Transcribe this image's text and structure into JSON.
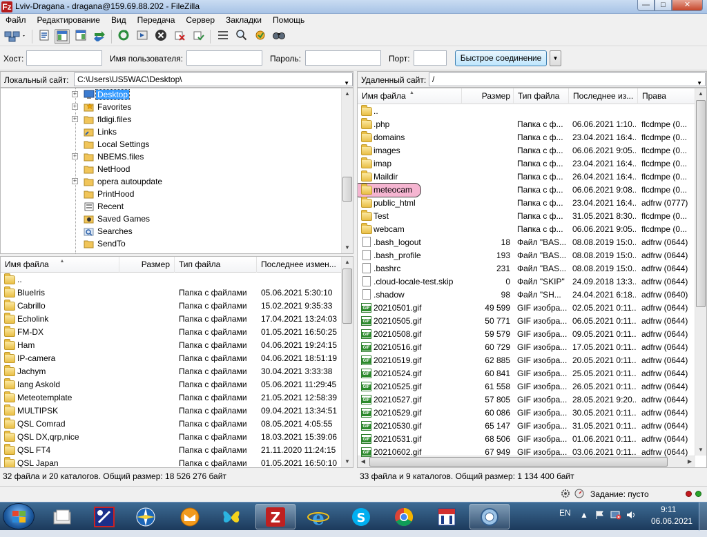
{
  "title": {
    "text": "Lviv-Dragana - dragana@159.69.88.202 - FileZilla",
    "app_icon": "Fz"
  },
  "menu": [
    "Файл",
    "Редактирование",
    "Вид",
    "Передача",
    "Сервер",
    "Закладки",
    "Помощь"
  ],
  "quickconnect": {
    "host_label": "Хост:",
    "host_value": "",
    "user_label": "Имя пользователя:",
    "user_value": "",
    "pass_label": "Пароль:",
    "pass_value": "",
    "port_label": "Порт:",
    "port_value": "",
    "button": "Быстрое соединение"
  },
  "local": {
    "site_label": "Локальный сайт:",
    "path": "C:\\Users\\US5WAC\\Desktop\\",
    "tree": [
      {
        "name": "Desktop",
        "icon": "desktop-icon",
        "expander": "+",
        "selected": true
      },
      {
        "name": "Favorites",
        "icon": "star-folder-icon",
        "expander": "+"
      },
      {
        "name": "fldigi.files",
        "icon": "folder-icon",
        "expander": "+"
      },
      {
        "name": "Links",
        "icon": "links-folder-icon",
        "expander": ""
      },
      {
        "name": "Local Settings",
        "icon": "folder-icon",
        "expander": ""
      },
      {
        "name": "NBEMS.files",
        "icon": "folder-icon",
        "expander": "+"
      },
      {
        "name": "NetHood",
        "icon": "folder-icon",
        "expander": ""
      },
      {
        "name": "opera autoupdate",
        "icon": "folder-icon",
        "expander": "+"
      },
      {
        "name": "PrintHood",
        "icon": "folder-icon",
        "expander": ""
      },
      {
        "name": "Recent",
        "icon": "recent-icon",
        "expander": ""
      },
      {
        "name": "Saved Games",
        "icon": "saved-games-icon",
        "expander": ""
      },
      {
        "name": "Searches",
        "icon": "search-folder-icon",
        "expander": ""
      },
      {
        "name": "SendTo",
        "icon": "folder-icon",
        "expander": ""
      }
    ],
    "columns": {
      "name": "Имя файла",
      "size": "Размер",
      "type": "Тип файла",
      "modified": "Последнее измен..."
    },
    "files": [
      {
        "name": "..",
        "type": "",
        "modified": ""
      },
      {
        "name": "BlueIris",
        "type": "Папка с файлами",
        "modified": "05.06.2021 5:30:10"
      },
      {
        "name": "Cabrillo",
        "type": "Папка с файлами",
        "modified": "15.02.2021 9:35:33"
      },
      {
        "name": "Echolink",
        "type": "Папка с файлами",
        "modified": "17.04.2021 13:24:03"
      },
      {
        "name": "FM-DX",
        "type": "Папка с файлами",
        "modified": "01.05.2021 16:50:25"
      },
      {
        "name": "Ham",
        "type": "Папка с файлами",
        "modified": "04.06.2021 19:24:15"
      },
      {
        "name": "IP-camera",
        "type": "Папка с файлами",
        "modified": "04.06.2021 18:51:19"
      },
      {
        "name": "Jachym",
        "type": "Папка с файлами",
        "modified": "30.04.2021 3:33:38"
      },
      {
        "name": "Iang Askold",
        "type": "Папка с файлами",
        "modified": "05.06.2021 11:29:45"
      },
      {
        "name": "Meteotemplate",
        "type": "Папка с файлами",
        "modified": "21.05.2021 12:58:39"
      },
      {
        "name": "MULTIPSK",
        "type": "Папка с файлами",
        "modified": "09.04.2021 13:34:51"
      },
      {
        "name": "QSL Comrad",
        "type": "Папка с файлами",
        "modified": "08.05.2021 4:05:55"
      },
      {
        "name": "QSL DX,qrp,nice",
        "type": "Папка с файлами",
        "modified": "18.03.2021 15:39:06"
      },
      {
        "name": "QSL FT4",
        "type": "Папка с файлами",
        "modified": "21.11.2020 11:24:15"
      },
      {
        "name": "QSL Japan",
        "type": "Папка с файлами",
        "modified": "01.05.2021 16:50:10"
      }
    ],
    "status": "32 файла и 20 каталогов. Общий размер: 18 526 276 байт"
  },
  "remote": {
    "site_label": "Удаленный сайт:",
    "path": "/",
    "columns": {
      "name": "Имя файла",
      "size": "Размер",
      "type": "Тип файла",
      "modified": "Последнее из...",
      "perms": "Права"
    },
    "files": [
      {
        "name": "..",
        "kind": "folder",
        "size": "",
        "type": "",
        "modified": "",
        "perms": ""
      },
      {
        "name": ".php",
        "kind": "folder",
        "size": "",
        "type": "Папка с ф...",
        "modified": "06.06.2021 1:10...",
        "perms": "flcdmpe (0..."
      },
      {
        "name": "domains",
        "kind": "folder",
        "size": "",
        "type": "Папка с ф...",
        "modified": "23.04.2021 16:4...",
        "perms": "flcdmpe (0..."
      },
      {
        "name": "images",
        "kind": "folder",
        "size": "",
        "type": "Папка с ф...",
        "modified": "06.06.2021 9:05...",
        "perms": "flcdmpe (0..."
      },
      {
        "name": "imap",
        "kind": "folder",
        "size": "",
        "type": "Папка с ф...",
        "modified": "23.04.2021 16:4...",
        "perms": "flcdmpe (0..."
      },
      {
        "name": "Maildir",
        "kind": "folder",
        "size": "",
        "type": "Папка с ф...",
        "modified": "26.04.2021 16:4...",
        "perms": "flcdmpe (0..."
      },
      {
        "name": "meteocam",
        "kind": "folder",
        "size": "",
        "type": "Папка с ф...",
        "modified": "06.06.2021 9:08...",
        "perms": "flcdmpe (0...",
        "highlight": true
      },
      {
        "name": "public_html",
        "kind": "link",
        "size": "",
        "type": "Папка с ф...",
        "modified": "23.04.2021 16:4...",
        "perms": "adfrw (0777)"
      },
      {
        "name": "Test",
        "kind": "folder",
        "size": "",
        "type": "Папка с ф...",
        "modified": "31.05.2021 8:30...",
        "perms": "flcdmpe (0..."
      },
      {
        "name": "webcam",
        "kind": "folder",
        "size": "",
        "type": "Папка с ф...",
        "modified": "06.06.2021 9:05...",
        "perms": "flcdmpe (0..."
      },
      {
        "name": ".bash_logout",
        "kind": "doc",
        "size": "18",
        "type": "Файл \"BAS...",
        "modified": "08.08.2019 15:0...",
        "perms": "adfrw (0644)"
      },
      {
        "name": ".bash_profile",
        "kind": "doc",
        "size": "193",
        "type": "Файл \"BAS...",
        "modified": "08.08.2019 15:0...",
        "perms": "adfrw (0644)"
      },
      {
        "name": ".bashrc",
        "kind": "doc",
        "size": "231",
        "type": "Файл \"BAS...",
        "modified": "08.08.2019 15:0...",
        "perms": "adfrw (0644)"
      },
      {
        "name": ".cloud-locale-test.skip",
        "kind": "doc",
        "size": "0",
        "type": "Файл \"SKIP\"",
        "modified": "24.09.2018 13:3...",
        "perms": "adfrw (0644)"
      },
      {
        "name": ".shadow",
        "kind": "doc",
        "size": "98",
        "type": "Файл \"SH...",
        "modified": "24.04.2021 6:18...",
        "perms": "adfrw (0640)"
      },
      {
        "name": "20210501.gif",
        "kind": "gif",
        "size": "49 599",
        "type": "GIF изобра...",
        "modified": "02.05.2021 0:11...",
        "perms": "adfrw (0644)"
      },
      {
        "name": "20210505.gif",
        "kind": "gif",
        "size": "50 771",
        "type": "GIF изобра...",
        "modified": "06.05.2021 0:11...",
        "perms": "adfrw (0644)"
      },
      {
        "name": "20210508.gif",
        "kind": "gif",
        "size": "59 579",
        "type": "GIF изобра...",
        "modified": "09.05.2021 0:11...",
        "perms": "adfrw (0644)"
      },
      {
        "name": "20210516.gif",
        "kind": "gif",
        "size": "60 729",
        "type": "GIF изобра...",
        "modified": "17.05.2021 0:11...",
        "perms": "adfrw (0644)"
      },
      {
        "name": "20210519.gif",
        "kind": "gif",
        "size": "62 885",
        "type": "GIF изобра...",
        "modified": "20.05.2021 0:11...",
        "perms": "adfrw (0644)"
      },
      {
        "name": "20210524.gif",
        "kind": "gif",
        "size": "60 841",
        "type": "GIF изобра...",
        "modified": "25.05.2021 0:11...",
        "perms": "adfrw (0644)"
      },
      {
        "name": "20210525.gif",
        "kind": "gif",
        "size": "61 558",
        "type": "GIF изобра...",
        "modified": "26.05.2021 0:11...",
        "perms": "adfrw (0644)"
      },
      {
        "name": "20210527.gif",
        "kind": "gif",
        "size": "57 805",
        "type": "GIF изобра...",
        "modified": "28.05.2021 9:20...",
        "perms": "adfrw (0644)"
      },
      {
        "name": "20210529.gif",
        "kind": "gif",
        "size": "60 086",
        "type": "GIF изобра...",
        "modified": "30.05.2021 0:11...",
        "perms": "adfrw (0644)"
      },
      {
        "name": "20210530.gif",
        "kind": "gif",
        "size": "65 147",
        "type": "GIF изобра...",
        "modified": "31.05.2021 0:11...",
        "perms": "adfrw (0644)"
      },
      {
        "name": "20210531.gif",
        "kind": "gif",
        "size": "68 506",
        "type": "GIF изобра...",
        "modified": "01.06.2021 0:11...",
        "perms": "adfrw (0644)"
      },
      {
        "name": "20210602.gif",
        "kind": "gif",
        "size": "67 949",
        "type": "GIF изобра...",
        "modified": "03.06.2021 0:11...",
        "perms": "adfrw (0644)"
      }
    ],
    "status": "33 файла и 9 каталогов. Общий размер: 1 134 400 байт"
  },
  "queue": {
    "label": "Задание: пусто"
  },
  "tray": {
    "lang": "EN",
    "time": "9:11",
    "date": "06.06.2021"
  },
  "colors": {
    "selection": "#3399ff",
    "highlight_pink": "#f4a9c9",
    "taskbar": "#2a5079"
  }
}
